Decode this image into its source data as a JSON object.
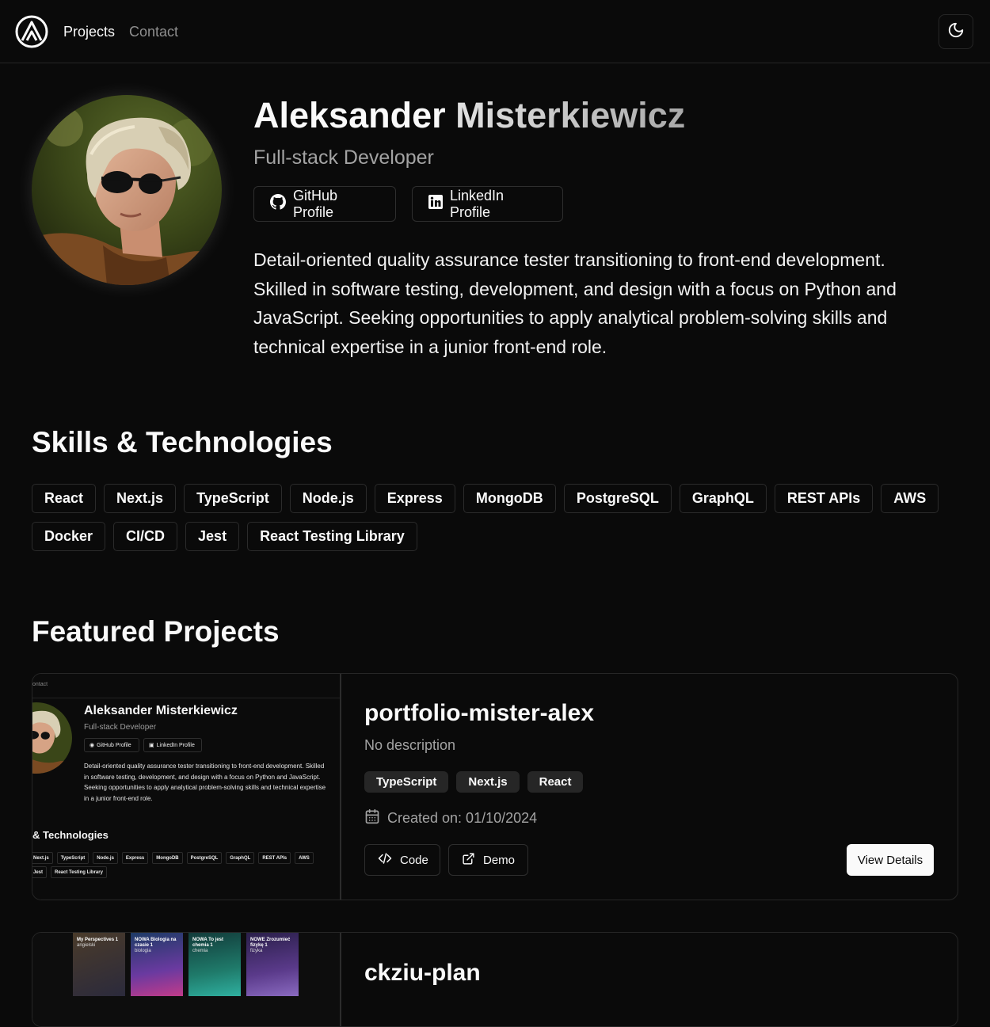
{
  "nav": {
    "logo": "logo-icon",
    "links": [
      {
        "label": "Projects",
        "active": true
      },
      {
        "label": "Contact",
        "active": false
      }
    ],
    "theme_toggle_icon": "moon-icon"
  },
  "hero": {
    "name_first": "Aleksander",
    "name_last": "Misterkiewicz",
    "role": "Full-stack Developer",
    "github_label": "GitHub Profile",
    "linkedin_label": "LinkedIn Profile",
    "bio": "Detail-oriented quality assurance tester transitioning to front-end development. Skilled in software testing, development, and design with a focus on Python and JavaScript. Seeking opportunities to apply analytical problem-solving skills and technical expertise in a junior front-end role."
  },
  "skills": {
    "title": "Skills & Technologies",
    "items": [
      "React",
      "Next.js",
      "TypeScript",
      "Node.js",
      "Express",
      "MongoDB",
      "PostgreSQL",
      "GraphQL",
      "REST APIs",
      "AWS",
      "Docker",
      "CI/CD",
      "Jest",
      "React Testing Library"
    ]
  },
  "projects": {
    "title": "Featured Projects",
    "items": [
      {
        "name": "portfolio-mister-alex",
        "description": "No description",
        "tags": [
          "TypeScript",
          "Next.js",
          "React"
        ],
        "created": "Created on: 01/10/2024",
        "code_label": "Code",
        "demo_label": "Demo",
        "details_label": "View Details",
        "thumb": {
          "nav_text": "ontact",
          "name": "Aleksander Misterkiewicz",
          "role": "Full-stack Developer",
          "github": "GitHub Profile",
          "linkedin": "LinkedIn Profile",
          "bio": "Detail-oriented quality assurance tester transitioning to front-end development. Skilled in software testing, development, and design with a focus on Python and JavaScript. Seeking opportunities to apply analytical problem-solving skills and technical expertise in a junior front-end role.",
          "section": "& Technologies",
          "chips_row1": [
            "Next.js",
            "TypeScript",
            "Node.js",
            "Express",
            "MongoDB",
            "PostgreSQL",
            "GraphQL",
            "REST APIs",
            "AWS"
          ],
          "chips_row2": [
            "Jest",
            "React Testing Library"
          ]
        }
      },
      {
        "name": "ckziu-plan",
        "thumb_books": [
          {
            "title": "My Perspectives 1",
            "sub": "angielski"
          },
          {
            "title": "NOWA Biologia na czasie 1",
            "sub": "biologia"
          },
          {
            "title": "NOWA To jest chemia 1",
            "sub": "chemia"
          },
          {
            "title": "NOWE Zrozumieć fizykę 1",
            "sub": "fizyka"
          }
        ]
      }
    ]
  },
  "colors": {
    "background": "#0a0a0a",
    "border": "#262626",
    "muted_text": "#a3a3a3",
    "tag_bg": "#262626"
  }
}
